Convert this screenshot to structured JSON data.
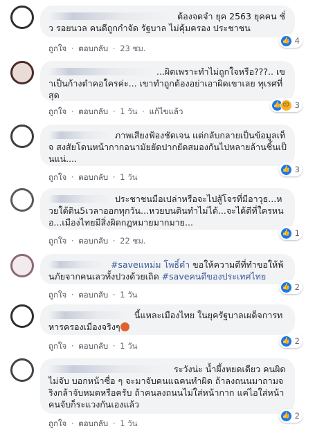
{
  "comments": [
    {
      "text": "ต้องจดจำ ยุค 2563 ยุคคน ชั่ว รอยนวล คนดีถูกกำจัด รัฐบาล ไม่คุ้มครอง ประชาชน",
      "like_label": "ถูกใจ",
      "reply_label": "ตอบกลับ",
      "time": "23 ชม.",
      "reaction_count": "4",
      "reaction_icons": [
        "like-icon"
      ]
    },
    {
      "text": "...ผิดเพราะทำไม่ถูกใจหรือ???.. เขาเป็นก้างตำคอใครค่ะ... เขาทำถูกต้องอย่าเอาผิดเขาเลย ทุเรศที่สุด",
      "like_label": "ถูกใจ",
      "reply_label": "ตอบกลับ",
      "time": "1 วัน",
      "edited_label": "แก้ไขแล้ว",
      "reaction_count": "3",
      "reaction_icons": [
        "like-icon",
        "sad-icon"
      ]
    },
    {
      "text": "ภาพเสียงฟ้องชัดเจน แต่กลับกลายเป็นข้อมูลเท็จ สงสัยโดนหน้ากากอนามัยยัดปากยัดสมองกันไปหลายล้านชิ้นเป็นแน่....",
      "like_label": "ถูกใจ",
      "reply_label": "ตอบกลับ",
      "time": "1 วัน",
      "reaction_count": "3",
      "reaction_icons": [
        "like-icon"
      ]
    },
    {
      "text": "ประชาชนมือเปล่าหรือจะไปสู้โจรที่มีอาวุธ...หวยใต้ดิน5เวลาออกทุกวัน...หวยบนดินทำไม่ได้...จะได้ดีที่ใครหนอ...เมืองไทยมีสิ่งผิดกฎหมายมากมาย...",
      "like_label": "ถูกใจ",
      "reply_label": "ตอบกลับ",
      "time": "22 ชม.",
      "reaction_count": "1",
      "reaction_icons": [
        "like-icon"
      ]
    },
    {
      "hashtag1": "#saveแหม่ม โพธิ์ดำ",
      "text_mid": " ขอให้ความดีที่ทำขอให้พ้นภัยจากคนเลวทั้งปวงด้วยเถิด ",
      "hashtag2": "#saveคนดีของประเทศไทย",
      "like_label": "ถูกใจ",
      "reply_label": "ตอบกลับ",
      "time": "1 วัน",
      "reaction_count": "2",
      "reaction_icons": [
        "like-icon"
      ]
    },
    {
      "text": "นี้แหละเมืองไทย ในยุครัฐบาลเผด็จการทหารครองเมืองจริงๆ",
      "like_label": "ถูกใจ",
      "reply_label": "ตอบกลับ",
      "time": "1 วัน",
      "reaction_count": "2",
      "reaction_icons": [
        "like-icon"
      ]
    },
    {
      "text": "ระวังน่ะ น้ำผึ้งหยดเดียว คนผิดไม่จับ บอกหน้าซื่อ ๆ จะมาจับคนแฉคนทำผิด ถ้าลงถนนมาถามจริงกล้าจับหมดหรือครับ ถ้าคนลงถนนไม่ใส่หน้ากาก แค่ไอใส่หน้า คนจับก็ระแวงกันเองแล้ว",
      "like_label": "ถูกใจ",
      "reply_label": "ตอบกลับ",
      "time": "1 วัน",
      "reaction_count": "2",
      "reaction_icons": [
        "like-icon"
      ]
    }
  ],
  "separator": "·",
  "colors": {
    "bubble": "#f2f3f5",
    "link": "#385898",
    "meta": "#606770",
    "like": "#1877f2",
    "sad": "#f7b125"
  }
}
